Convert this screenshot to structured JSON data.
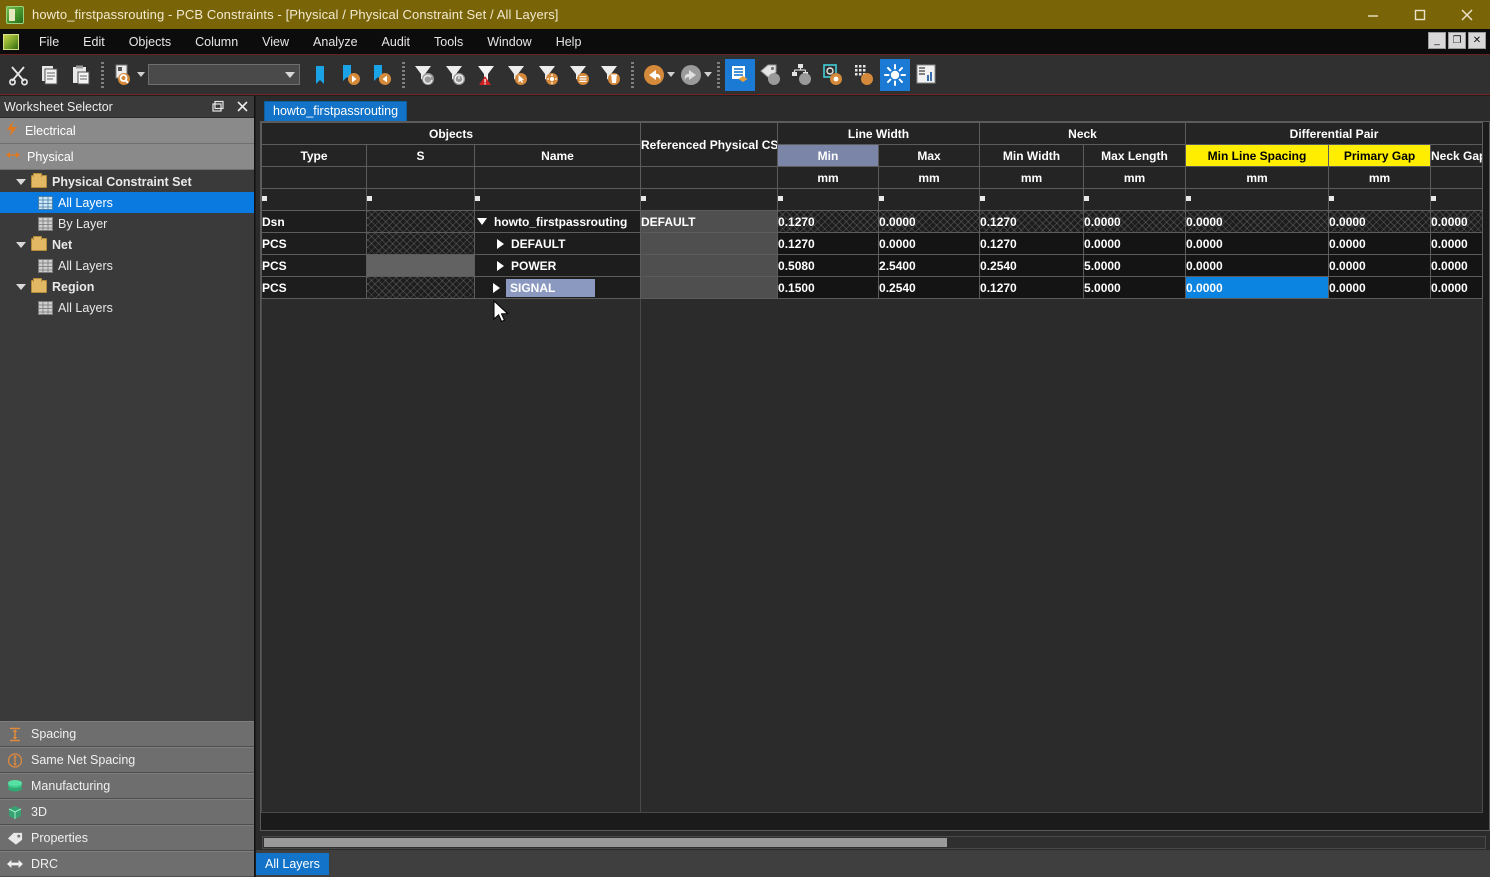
{
  "window": {
    "title": "howto_firstpassrouting - PCB Constraints - [Physical / Physical Constraint Set / All Layers]",
    "minimize_label": "–",
    "maximize_label": "☐",
    "close_label": "×"
  },
  "mdi": {
    "minimize": "_",
    "restore": "❐",
    "close": "✕"
  },
  "menu": {
    "items": [
      "File",
      "Edit",
      "Objects",
      "Column",
      "View",
      "Analyze",
      "Audit",
      "Tools",
      "Window",
      "Help"
    ]
  },
  "toolbar": {
    "combo_value": "",
    "items": [
      {
        "name": "cut-icon",
        "title": "Cut"
      },
      {
        "name": "copy-icon",
        "title": "Copy"
      },
      {
        "name": "paste-icon",
        "title": "Paste"
      },
      {
        "name": "find-icon",
        "title": "Find"
      },
      {
        "name": "bookmark-icon",
        "title": "Bookmark"
      },
      {
        "name": "bookmark-next-icon",
        "title": "Next Bookmark"
      },
      {
        "name": "bookmark-prev-icon",
        "title": "Previous Bookmark"
      },
      {
        "name": "filter-clear-icon",
        "title": "Clear Filter"
      },
      {
        "name": "filter-history-icon",
        "title": "Filter History"
      },
      {
        "name": "filter-error-icon",
        "title": "Filter Errors"
      },
      {
        "name": "filter-select-icon",
        "title": "Filter Selected"
      },
      {
        "name": "filter-options-icon",
        "title": "Filter Options"
      },
      {
        "name": "filter-list-icon",
        "title": "Filter List"
      },
      {
        "name": "filter-delete-icon",
        "title": "Delete Filter"
      },
      {
        "name": "undo-icon",
        "title": "Undo"
      },
      {
        "name": "redo-icon",
        "title": "Redo"
      },
      {
        "name": "show-worksheet-icon",
        "title": "Worksheet Selector"
      },
      {
        "name": "tag-icon",
        "title": "Properties"
      },
      {
        "name": "hierarchy-icon",
        "title": "Hierarchy"
      },
      {
        "name": "target-icon",
        "title": "Target"
      },
      {
        "name": "matrix-icon",
        "title": "Matrix"
      },
      {
        "name": "brightness-icon",
        "title": "Highlight"
      },
      {
        "name": "report-icon",
        "title": "Report"
      }
    ]
  },
  "sidebar": {
    "panel_title": "Worksheet Selector",
    "groups": [
      {
        "label": "Electrical",
        "icon": "lightning-icon"
      },
      {
        "label": "Physical",
        "icon": "arrows-icon"
      }
    ],
    "tree": [
      {
        "label": "Physical Constraint Set",
        "type": "folder",
        "expanded": true,
        "selected": false
      },
      {
        "label": "All Layers",
        "type": "leaf",
        "selected": true
      },
      {
        "label": "By Layer",
        "type": "leaf",
        "selected": false
      },
      {
        "label": "Net",
        "type": "folder",
        "expanded": true,
        "selected": false
      },
      {
        "label": "All Layers",
        "type": "leaf",
        "selected": false
      },
      {
        "label": "Region",
        "type": "folder",
        "expanded": true,
        "selected": false
      },
      {
        "label": "All Layers",
        "type": "leaf",
        "selected": false
      }
    ],
    "bottom_items": [
      {
        "label": "Spacing",
        "icon": "spacing-icon"
      },
      {
        "label": "Same Net Spacing",
        "icon": "same-net-spacing-icon"
      },
      {
        "label": "Manufacturing",
        "icon": "manufacturing-icon"
      },
      {
        "label": "3D",
        "icon": "three-d-icon"
      },
      {
        "label": "Properties",
        "icon": "properties-tag-icon"
      },
      {
        "label": "DRC",
        "icon": "drc-icon"
      }
    ]
  },
  "sheet": {
    "tab_label": "howto_firstpassrouting",
    "status_tab_label": "All Layers",
    "groups": [
      {
        "label": "Objects",
        "span": 3
      },
      {
        "label": "",
        "span": 1
      },
      {
        "label": "Line Width",
        "span": 2
      },
      {
        "label": "Neck",
        "span": 2
      },
      {
        "label": "Differential Pair",
        "span": 3
      }
    ],
    "columns": [
      {
        "label": "Type",
        "unit": "",
        "state": "normal"
      },
      {
        "label": "S",
        "unit": "",
        "state": "normal"
      },
      {
        "label": "Name",
        "unit": "",
        "state": "normal"
      },
      {
        "label": "Referenced Physical CSet",
        "unit": "",
        "state": "normal"
      },
      {
        "label": "Min",
        "unit": "mm",
        "state": "selected"
      },
      {
        "label": "Max",
        "unit": "mm",
        "state": "normal"
      },
      {
        "label": "Min Width",
        "unit": "mm",
        "state": "normal"
      },
      {
        "label": "Max Length",
        "unit": "mm",
        "state": "normal"
      },
      {
        "label": "Min Line Spacing",
        "unit": "mm",
        "state": "highlight"
      },
      {
        "label": "Primary Gap",
        "unit": "mm",
        "state": "highlight"
      },
      {
        "label": "Neck Gap",
        "unit": "",
        "state": "normal"
      }
    ],
    "filter_marker": "*",
    "rows": [
      {
        "type": "Dsn",
        "s": "",
        "name": "howto_firstpassrouting",
        "indent": 1,
        "expander": "down",
        "name_selected": false,
        "ref_cset": "DEFAULT",
        "values": [
          "0.1270",
          "0.0000",
          "0.1270",
          "0.0000",
          "0.0000",
          "0.0000",
          "0.0000"
        ],
        "hatched": true
      },
      {
        "type": "PCS",
        "s": "",
        "name": "DEFAULT",
        "indent": 2,
        "expander": "right",
        "name_selected": false,
        "ref_cset": "",
        "values": [
          "0.1270",
          "0.0000",
          "0.1270",
          "0.0000",
          "0.0000",
          "0.0000",
          "0.0000"
        ],
        "hatched": true
      },
      {
        "type": "PCS",
        "s": "",
        "name": "POWER",
        "indent": 2,
        "expander": "right",
        "name_selected": false,
        "ref_cset": "",
        "values": [
          "0.5080",
          "2.5400",
          "0.2540",
          "5.0000",
          "0.0000",
          "0.0000",
          "0.0000"
        ],
        "hatched": false
      },
      {
        "type": "PCS",
        "s": "",
        "name": "SIGNAL",
        "indent": 2,
        "expander": "right",
        "name_selected": true,
        "ref_cset": "",
        "values": [
          "0.1500",
          "0.2540",
          "0.1270",
          "5.0000",
          "0.0000",
          "0.0000",
          "0.0000"
        ],
        "hatched": true,
        "selected_value_index": 4
      }
    ]
  },
  "colors": {
    "title_bar": "#7a6408",
    "accent_blue": "#1273c8",
    "selection_blue": "#0a84e0",
    "header_highlight_yellow": "#ffee00",
    "column_selected": "#7a85a8",
    "cset_link": "#2bb8c8",
    "sidebar_bg": "#3a3a3a",
    "grid_bg": "#141414"
  }
}
